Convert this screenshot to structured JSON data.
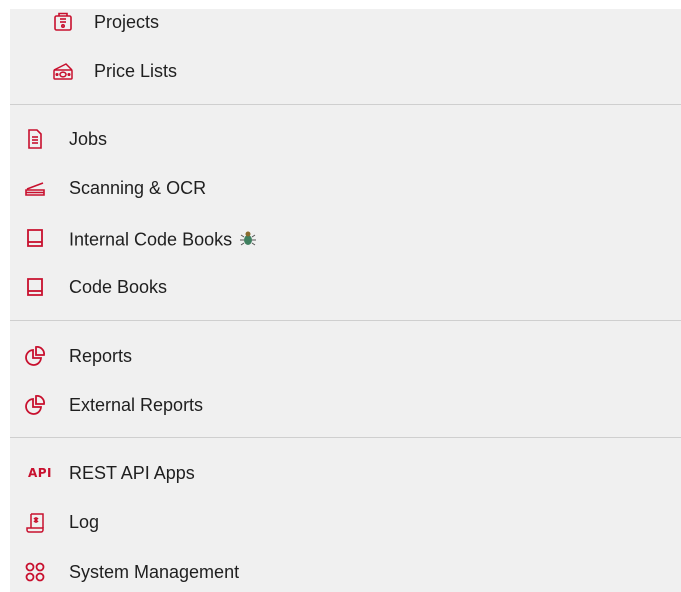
{
  "menu": {
    "projects": {
      "label": "Projects",
      "icon": "projects-icon"
    },
    "price_lists": {
      "label": "Price Lists",
      "icon": "price-lists-icon"
    },
    "jobs": {
      "label": "Jobs",
      "icon": "document-icon"
    },
    "scanning": {
      "label": "Scanning & OCR",
      "icon": "scanner-icon"
    },
    "internal_code_books": {
      "label": "Internal Code Books",
      "icon": "book-icon",
      "badge_icon": "bug-icon"
    },
    "code_books": {
      "label": "Code Books",
      "icon": "book-icon"
    },
    "reports": {
      "label": "Reports",
      "icon": "pie-chart-icon"
    },
    "external_reports": {
      "label": "External Reports",
      "icon": "pie-chart-icon"
    },
    "rest_api": {
      "label": "REST API Apps",
      "icon_text": "API"
    },
    "log": {
      "label": "Log",
      "icon": "scroll-icon"
    },
    "system_management": {
      "label": "System Management",
      "icon": "grid-icon"
    }
  },
  "colors": {
    "accent": "#c8102e",
    "background": "#f0f0f0",
    "divider": "#cfcfcf",
    "text": "#1f1f1f"
  }
}
